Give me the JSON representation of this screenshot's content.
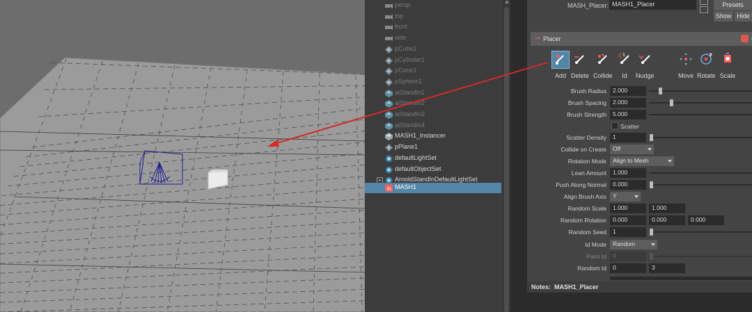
{
  "outliner": {
    "items": [
      {
        "label": "persp",
        "state": "dim",
        "icon": "camera-icon"
      },
      {
        "label": "top",
        "state": "dim",
        "icon": "camera-icon"
      },
      {
        "label": "front",
        "state": "dim",
        "icon": "camera-icon"
      },
      {
        "label": "side",
        "state": "dim",
        "icon": "camera-icon"
      },
      {
        "label": "pCube1",
        "state": "dim",
        "icon": "transform-icon"
      },
      {
        "label": "pCylinder1",
        "state": "dim",
        "icon": "transform-icon"
      },
      {
        "label": "pCone1",
        "state": "dim",
        "icon": "transform-icon"
      },
      {
        "label": "pSphere1",
        "state": "dim",
        "icon": "transform-icon"
      },
      {
        "label": "aiStandIn1",
        "state": "dim",
        "icon": "standin-icon"
      },
      {
        "label": "aiStandIn2",
        "state": "dim",
        "icon": "standin-icon"
      },
      {
        "label": "aiStandIn3",
        "state": "dim",
        "icon": "standin-icon"
      },
      {
        "label": "aiStandIn4",
        "state": "dim",
        "icon": "standin-icon"
      },
      {
        "label": "MASH1_Instancer",
        "state": "norm",
        "icon": "instancer-icon"
      },
      {
        "label": "pPlane1",
        "state": "norm",
        "icon": "transform-icon"
      },
      {
        "label": "defaultLightSet",
        "state": "norm",
        "icon": "set-icon"
      },
      {
        "label": "defaultObjectSet",
        "state": "norm",
        "icon": "set-icon"
      },
      {
        "label": "ArnoldStandInDefaultLightSet",
        "state": "norm",
        "icon": "set-icon",
        "expandable": true
      },
      {
        "label": "MASH1",
        "state": "sel",
        "icon": "mash-icon"
      }
    ]
  },
  "attr": {
    "node_label": "MASH_Placer:",
    "node_value": "MASH1_Placer",
    "presets_label": "Presets",
    "show_label": "Show",
    "hide_label": "Hide",
    "section_title": "Placer",
    "tools": [
      {
        "label": "Add",
        "icon": "brush-add-icon",
        "active": true
      },
      {
        "label": "Delete",
        "icon": "brush-delete-icon"
      },
      {
        "label": "Collide",
        "icon": "brush-collide-icon"
      },
      {
        "label": "Id",
        "icon": "brush-id-icon"
      },
      {
        "label": "Nudge",
        "icon": "brush-nudge-icon"
      },
      {
        "label": "Move",
        "icon": "move-icon"
      },
      {
        "label": "Rotate",
        "icon": "rotate-icon"
      },
      {
        "label": "Scale",
        "icon": "scale-icon"
      }
    ],
    "brush_radius": {
      "label": "Brush Radius",
      "value": "2.000",
      "slider": 0.1
    },
    "brush_spacing": {
      "label": "Brush Spacing",
      "value": "2.000",
      "slider": 0.22
    },
    "brush_strength": {
      "label": "Brush Strength",
      "value": "5.000"
    },
    "scatter": {
      "label": "Scatter"
    },
    "scatter_density": {
      "label": "Scatter Density",
      "value": "1"
    },
    "collide_on_create": {
      "label": "Collide on Create",
      "value": "Off"
    },
    "rotation_mode": {
      "label": "Rotation Mode",
      "value": "Align to Mesh"
    },
    "lean_amount": {
      "label": "Lean Amount",
      "value": "1.000"
    },
    "push_along_normal": {
      "label": "Push Along Normal",
      "value": "0.000"
    },
    "align_brush_axis": {
      "label": "Align Brush Axis",
      "value": "Y"
    },
    "random_scale": {
      "label": "Random Scale",
      "v1": "1.000",
      "v2": "1.000"
    },
    "random_rotation": {
      "label": "Random Rotation",
      "v1": "0.000",
      "v2": "0.000",
      "v3": "0.000"
    },
    "random_seed": {
      "label": "Random Seed",
      "value": "1"
    },
    "id_mode": {
      "label": "Id Mode",
      "value": "Random"
    },
    "paint_id": {
      "label": "Paint Id",
      "value": "0"
    },
    "random_id": {
      "label": "Random Id",
      "v1": "0",
      "v2": "3"
    },
    "notes_label": "Notes:",
    "notes_node": "MASH1_Placer"
  },
  "colors": {
    "viewport_bg": "#6d6d6d",
    "plane": "#9b9b9b",
    "selection": "#5285a6",
    "locator": "#1c1c8f",
    "annotation": "#d42a2a"
  }
}
